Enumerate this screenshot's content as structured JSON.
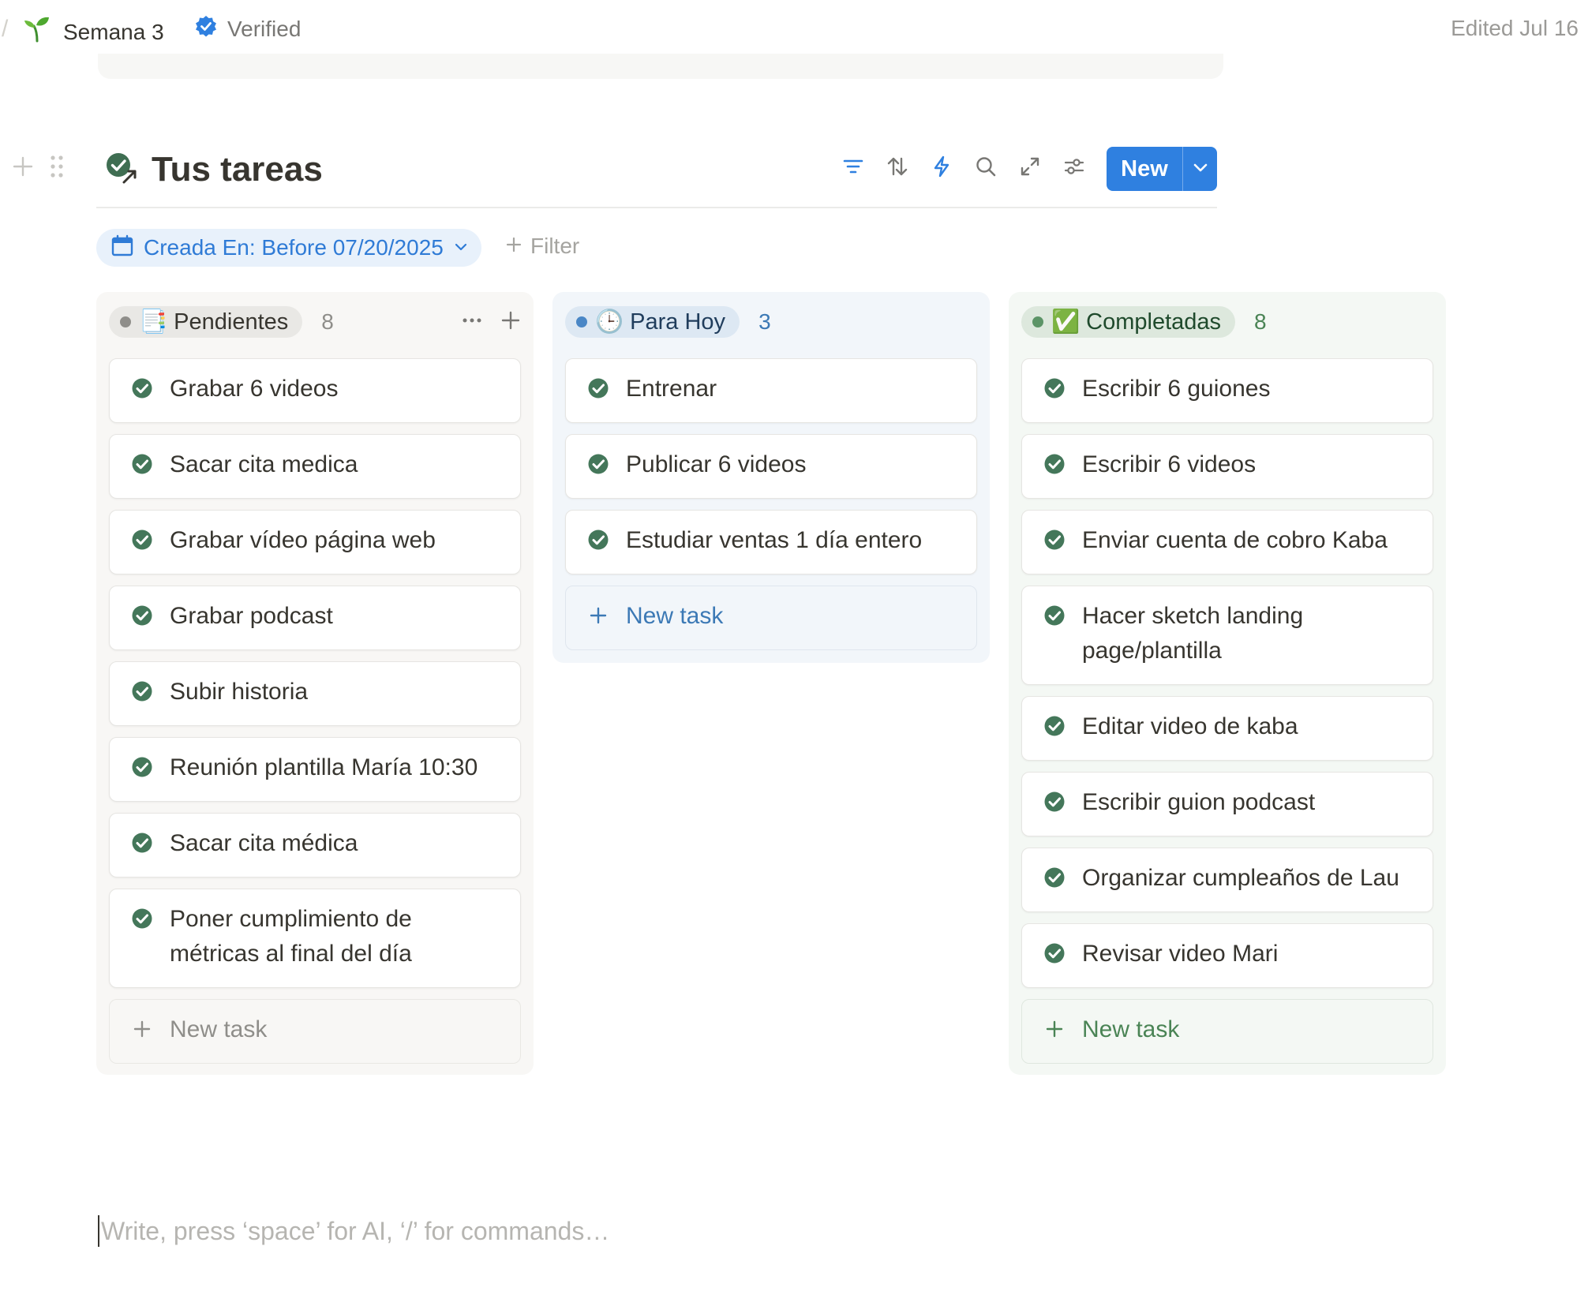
{
  "topbar": {
    "page_icon": "seedling-emoji",
    "page_title": "Semana 3",
    "verified_icon": "verified-badge-icon",
    "verified_label": "Verified",
    "edited_label": "Edited Jul 16"
  },
  "database": {
    "title": "Tus tareas",
    "title_icon": "check-circle-arrow-icon",
    "toolbar_icons": [
      "filter-icon",
      "sort-icon",
      "automation-bolt-icon",
      "search-icon",
      "expand-icon",
      "settings-sliders-icon"
    ],
    "new_button_label": "New",
    "accent_color": "#2f80e0"
  },
  "filter": {
    "active_filter_label": "Creada En: Before 07/20/2025",
    "add_filter_label": "Filter"
  },
  "columns": [
    {
      "status": "📑 Pendientes",
      "count": "8",
      "color": "#8f8e8a",
      "tasks": [
        "Grabar 6 videos",
        "Sacar cita medica",
        "Grabar vídeo página web",
        "Grabar podcast",
        "Subir historia",
        "Reunión plantilla María 10:30",
        "Sacar cita médica",
        "Poner cumplimiento de métricas al final del día"
      ],
      "new_task_label": "New task"
    },
    {
      "status": "🕒 Para Hoy",
      "count": "3",
      "color": "#4a87c6",
      "tasks": [
        "Entrenar",
        "Publicar 6 videos",
        "Estudiar ventas 1 día entero"
      ],
      "new_task_label": "New task"
    },
    {
      "status": "✅ Completadas",
      "count": "8",
      "color": "#5c9467",
      "tasks": [
        "Escribir 6 guiones",
        "Escribir 6 videos",
        "Enviar cuenta de cobro Kaba",
        "Hacer sketch landing page/plantilla",
        "Editar video de kaba",
        "Escribir guion podcast",
        "Organizar cumpleaños de Lau",
        "Revisar video Mari"
      ],
      "new_task_label": "New task"
    }
  ],
  "editor": {
    "placeholder": "Write, press ‘space’ for AI, ‘/’ for commands…"
  }
}
